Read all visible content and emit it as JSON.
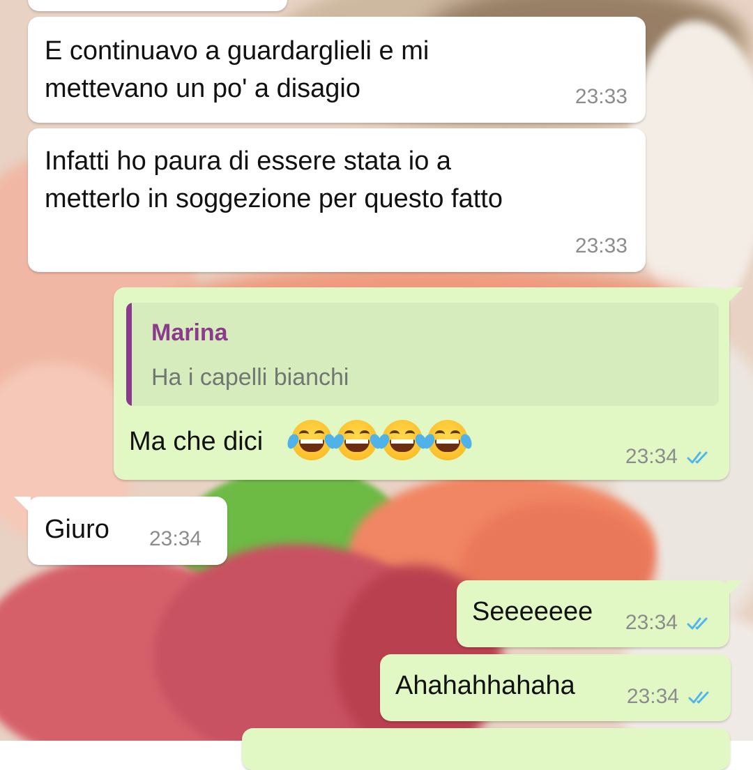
{
  "conversation": {
    "messages": [
      {
        "direction": "incoming",
        "text": "",
        "time": ""
      },
      {
        "direction": "incoming",
        "lines": [
          "E continuavo a guardarglieli e mi",
          "mettevano un po' a disagio"
        ],
        "time": "23:33"
      },
      {
        "direction": "incoming",
        "lines": [
          "Infatti ho paura di essere stata io a",
          "metterlo in soggezione per questo fatto"
        ],
        "time": "23:33"
      },
      {
        "direction": "outgoing",
        "quote": {
          "author": "Marina",
          "text": "Ha i capelli bianchi"
        },
        "text": "Ma che dici",
        "emoji": [
          "laughing-tears",
          "laughing-tears",
          "laughing-tears",
          "laughing-tears"
        ],
        "time": "23:34",
        "status": "read"
      },
      {
        "direction": "incoming",
        "text": "Giuro",
        "time": "23:34"
      },
      {
        "direction": "outgoing",
        "text": "Seeeeeee",
        "time": "23:34",
        "status": "read"
      },
      {
        "direction": "outgoing",
        "text": "Ahahahhahaha",
        "time": "23:34",
        "status": "read"
      },
      {
        "direction": "outgoing",
        "text": "",
        "time": ""
      }
    ]
  },
  "colors": {
    "incoming_bubble": "#ffffff",
    "outgoing_bubble": "#e1f7c4",
    "quote_accent": "#8b3a8c",
    "read_ticks": "#4fb6ec",
    "timestamp": "#8c8c8c"
  },
  "icons": {
    "read_status": "double-check-icon",
    "emoji": "face-with-tears-of-joy"
  }
}
